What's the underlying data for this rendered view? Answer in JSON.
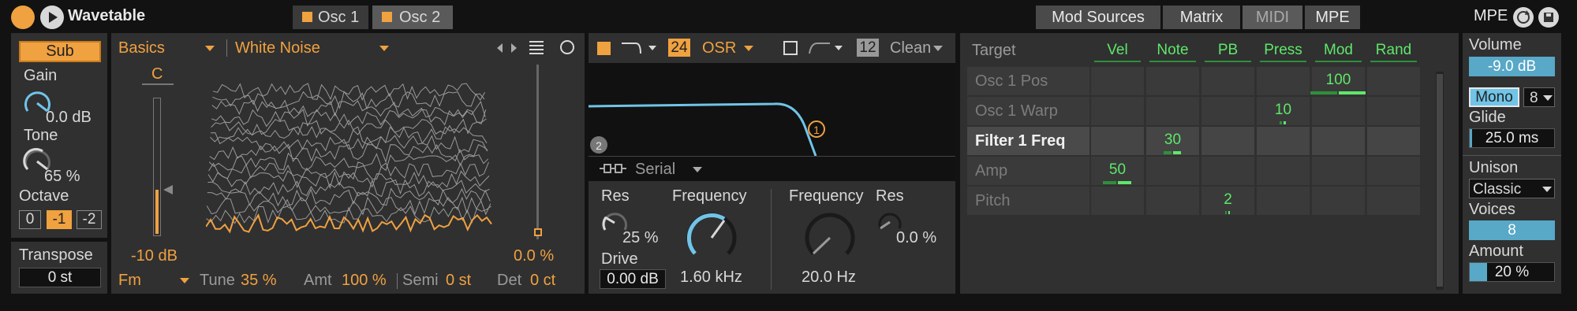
{
  "header": {
    "title": "Wavetable",
    "osc_tabs": [
      "Osc 1",
      "Osc 2"
    ],
    "right_tabs": [
      "Mod Sources",
      "Matrix",
      "MIDI",
      "MPE"
    ],
    "mpe_label": "MPE"
  },
  "sub": {
    "button": "Sub",
    "gain_label": "Gain",
    "gain_value": "0.0 dB",
    "tone_label": "Tone",
    "tone_value": "65 %",
    "octave_label": "Octave",
    "octave_options": [
      "0",
      "-1",
      "-2"
    ],
    "transpose_label": "Transpose",
    "transpose_value": "0 st"
  },
  "osc": {
    "category": "Basics",
    "wavetable": "White Noise",
    "pitch_note": "C",
    "level_value": "-10 dB",
    "position_value": "0.0 %",
    "fm_mode": "Fm",
    "tune_label": "Tune",
    "tune_value": "35 %",
    "amt_label": "Amt",
    "amt_value": "100 %",
    "semi_label": "Semi",
    "semi_value": "0 st",
    "det_label": "Det",
    "det_value": "0 ct"
  },
  "filter": {
    "slope_1": "24",
    "osr_label": "OSR",
    "slope_2": "12",
    "circuit_2": "Clean",
    "routing": "Serial",
    "marker_1": "1",
    "marker_2": "2",
    "f1_res_label": "Res",
    "f1_res_value": "25 %",
    "f1_freq_label": "Frequency",
    "f1_freq_value": "1.60 kHz",
    "drive_label": "Drive",
    "drive_value": "0.00 dB",
    "f2_freq_label": "Frequency",
    "f2_freq_value": "20.0 Hz",
    "f2_res_label": "Res",
    "f2_res_value": "0.0 %"
  },
  "matrix": {
    "target_header": "Target",
    "columns": [
      "Vel",
      "Note",
      "PB",
      "Press",
      "Mod",
      "Rand"
    ],
    "rows": [
      {
        "label": "Osc 1 Pos",
        "active": false,
        "values": [
          "",
          "",
          "",
          "",
          "100",
          ""
        ],
        "levels": [
          0,
          0,
          0,
          0,
          1.0,
          0
        ]
      },
      {
        "label": "Osc 1 Warp",
        "active": false,
        "values": [
          "",
          "",
          "",
          "10",
          "",
          ""
        ],
        "levels": [
          0,
          0,
          0,
          0.1,
          0,
          0
        ]
      },
      {
        "label": "Filter 1 Freq",
        "active": true,
        "values": [
          "",
          "30",
          "",
          "",
          "",
          ""
        ],
        "levels": [
          0,
          0.3,
          0,
          0,
          0,
          0
        ]
      },
      {
        "label": "Amp",
        "active": false,
        "values": [
          "50",
          "",
          "",
          "",
          "",
          ""
        ],
        "levels": [
          0.5,
          0,
          0,
          0,
          0,
          0
        ]
      },
      {
        "label": "Pitch",
        "active": false,
        "values": [
          "",
          "",
          "2",
          "",
          "",
          ""
        ],
        "levels": [
          0,
          0,
          0.02,
          0,
          0,
          0
        ]
      }
    ]
  },
  "global": {
    "volume_label": "Volume",
    "volume_value": "-9.0 dB",
    "mono_label": "Mono",
    "poly_value": "8",
    "glide_label": "Glide",
    "glide_value": "25.0 ms",
    "unison_label": "Unison",
    "unison_mode": "Classic",
    "voices_label": "Voices",
    "voices_value": "8",
    "amount_label": "Amount",
    "amount_value": "20 %"
  },
  "colors": {
    "accent": "#f0a140",
    "filter_curve": "#70c4e8",
    "mod_value": "#5ee76a",
    "active_tab": "#5a5a5a"
  }
}
